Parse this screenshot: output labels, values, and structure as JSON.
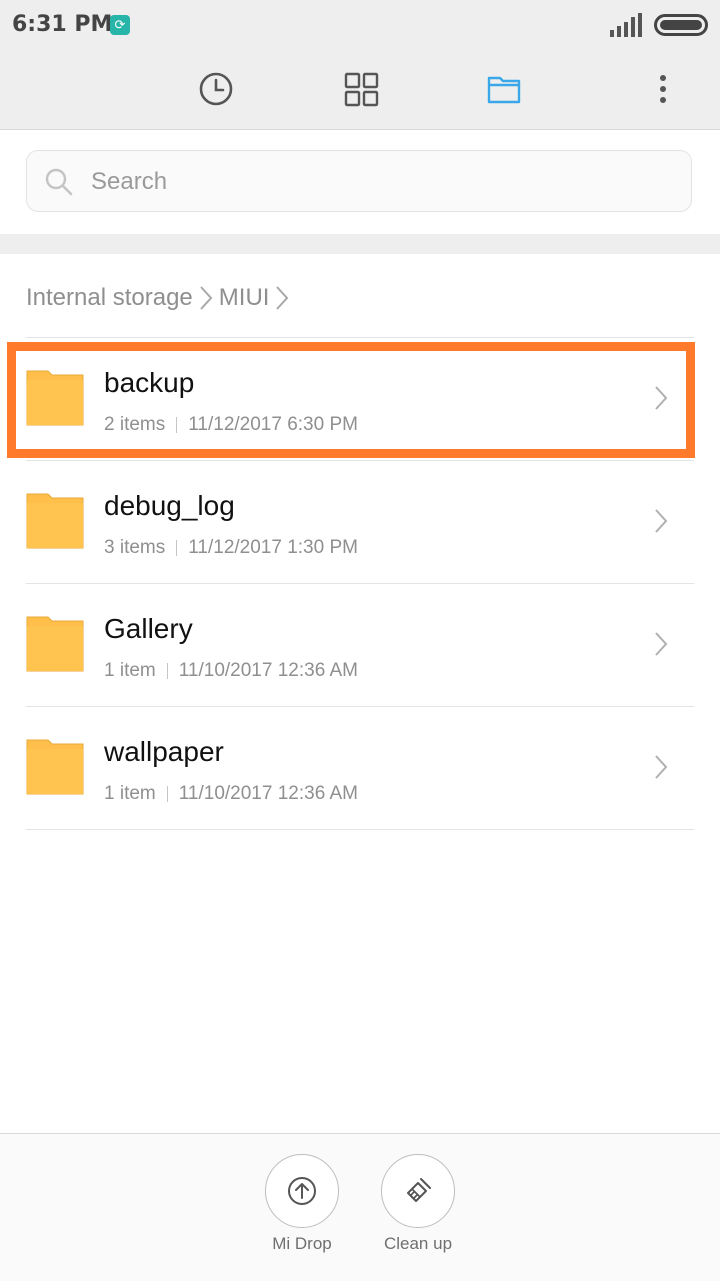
{
  "status_bar": {
    "time": "6:31 PM"
  },
  "toolbar": {
    "items": [
      {
        "icon": "clock-icon",
        "label": "recent"
      },
      {
        "icon": "grid-icon",
        "label": "categories"
      },
      {
        "icon": "folder-icon",
        "label": "files",
        "active": true
      },
      {
        "icon": "more-vertical-icon",
        "label": "more"
      }
    ],
    "active_color": "#3aa8e8"
  },
  "search": {
    "placeholder": "Search",
    "value": ""
  },
  "breadcrumb": {
    "items": [
      "Internal storage",
      "MIUI"
    ]
  },
  "folders": [
    {
      "name": "backup",
      "count": "2 items",
      "modified": "11/12/2017 6:30 PM",
      "highlighted": true
    },
    {
      "name": "debug_log",
      "count": "3 items",
      "modified": "11/12/2017 1:30 PM"
    },
    {
      "name": "Gallery",
      "count": "1 item",
      "modified": "11/10/2017 12:36 AM"
    },
    {
      "name": "wallpaper",
      "count": "1 item",
      "modified": "11/10/2017 12:36 AM"
    }
  ],
  "bottom_bar": {
    "midrop_label": "Mi Drop",
    "cleanup_label": "Clean up"
  },
  "colors": {
    "folder": "#ffbf4a",
    "highlight": "#ff7a2a"
  }
}
